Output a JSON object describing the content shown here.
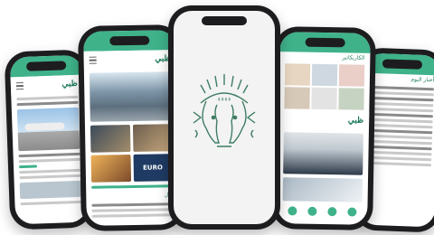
{
  "brand": {
    "accent": "#3fb28a",
    "dark": "#1d7b5a"
  },
  "phones": {
    "p1": {
      "logo": "ظبي"
    },
    "p2": {
      "logo": "ظبي",
      "section_label": "مال",
      "image_label": "EURO"
    },
    "p3": {
      "splash": "logo"
    },
    "p4": {
      "logo": "ظبي",
      "section_label": "الكاريكاتير"
    },
    "p5": {
      "section_label": "أخبار اليوم"
    }
  }
}
